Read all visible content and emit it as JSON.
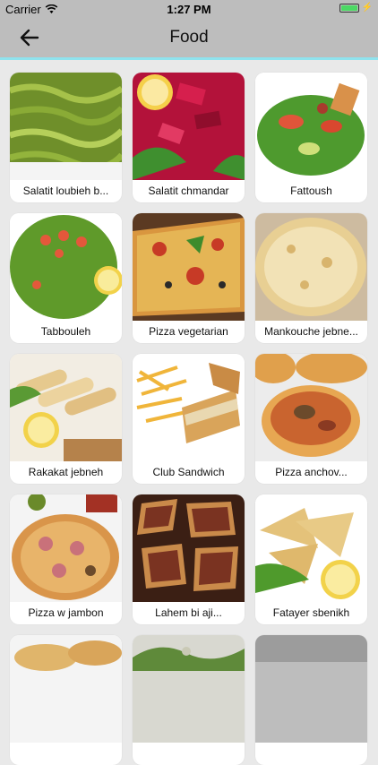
{
  "status": {
    "carrier": "Carrier",
    "time": "1:27 PM",
    "charging_symbol": "⚡",
    "battery_level": 1.0
  },
  "nav": {
    "title": "Food",
    "back_icon": "arrow-left-icon"
  },
  "colors": {
    "bar": "#bdbdbd",
    "bar_accent": "#8fe3ee",
    "background": "#e9e9e9",
    "battery": "#4cd964"
  },
  "items": [
    {
      "label": "Salatit loubieh b..."
    },
    {
      "label": "Salatit chmandar"
    },
    {
      "label": "Fattoush"
    },
    {
      "label": "Tabbouleh"
    },
    {
      "label": "Pizza vegetarian"
    },
    {
      "label": "Mankouche jebne..."
    },
    {
      "label": "Rakakat jebneh"
    },
    {
      "label": "Club Sandwich"
    },
    {
      "label": "Pizza anchov..."
    },
    {
      "label": "Pizza w jambon"
    },
    {
      "label": "Lahem bi aji..."
    },
    {
      "label": "Fatayer sbenikh"
    },
    {
      "label": ""
    },
    {
      "label": ""
    },
    {
      "label": ""
    }
  ]
}
